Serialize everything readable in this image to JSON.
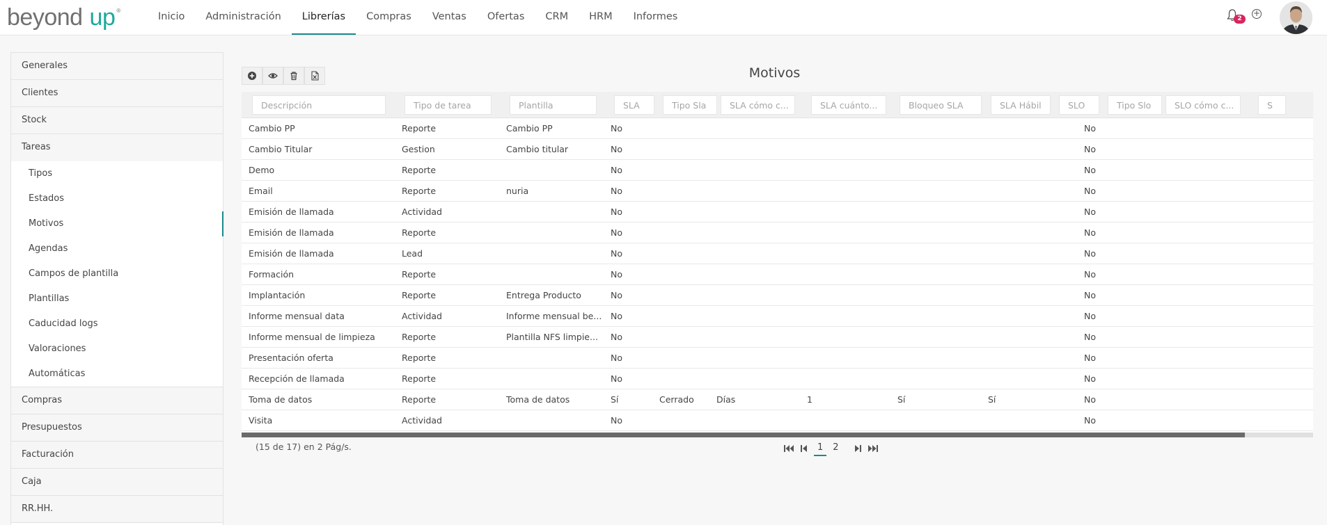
{
  "logo": {
    "word1": "beyond",
    "word2": "up",
    "reg": "®"
  },
  "nav": [
    "Inicio",
    "Administración",
    "Librerías",
    "Compras",
    "Ventas",
    "Ofertas",
    "CRM",
    "HRM",
    "Informes"
  ],
  "nav_active": "Librerías",
  "notifications": {
    "count": "2"
  },
  "sidebar": {
    "groups_top": [
      "Generales",
      "Clientes",
      "Stock",
      "Tareas"
    ],
    "tareas_subitems": [
      "Tipos",
      "Estados",
      "Motivos",
      "Agendas",
      "Campos de plantilla",
      "Plantillas",
      "Caducidad logs",
      "Valoraciones",
      "Automáticas"
    ],
    "active_subitem": "Motivos",
    "groups_bottom": [
      "Compras",
      "Presupuestos",
      "Facturación",
      "Caja",
      "RR.HH."
    ]
  },
  "page": {
    "title": "Motivos"
  },
  "toolbar": {
    "add": "add-icon",
    "view": "eye-icon",
    "delete": "trash-icon",
    "excel": "excel-icon"
  },
  "table": {
    "filters": [
      "Descripción",
      "Tipo de tarea",
      "Plantilla",
      "SLA",
      "Tipo Sla",
      "SLA cómo c...",
      "SLA cuánto...",
      "Bloqueo SLA",
      "SLA Hábil",
      "SLO",
      "Tipo Slo",
      "SLO cómo c...",
      "S"
    ],
    "rows": [
      [
        "Cambio PP",
        "Reporte",
        "Cambio PP",
        "No",
        "",
        "",
        "",
        "",
        "",
        "No"
      ],
      [
        "Cambio Titular",
        "Gestion",
        "Cambio titular",
        "No",
        "",
        "",
        "",
        "",
        "",
        "No"
      ],
      [
        "Demo",
        "Reporte",
        "",
        "No",
        "",
        "",
        "",
        "",
        "",
        "No"
      ],
      [
        "Email",
        "Reporte",
        "nuria",
        "No",
        "",
        "",
        "",
        "",
        "",
        "No"
      ],
      [
        "Emisión de llamada",
        "Actividad",
        "",
        "No",
        "",
        "",
        "",
        "",
        "",
        "No"
      ],
      [
        "Emisión de llamada",
        "Reporte",
        "",
        "No",
        "",
        "",
        "",
        "",
        "",
        "No"
      ],
      [
        "Emisión de llamada",
        "Lead",
        "",
        "No",
        "",
        "",
        "",
        "",
        "",
        "No"
      ],
      [
        "Formación",
        "Reporte",
        "",
        "No",
        "",
        "",
        "",
        "",
        "",
        "No"
      ],
      [
        "Implantación",
        "Reporte",
        "Entrega Producto",
        "No",
        "",
        "",
        "",
        "",
        "",
        "No"
      ],
      [
        "Informe mensual data",
        "Actividad",
        "Informe mensual be...",
        "No",
        "",
        "",
        "",
        "",
        "",
        "No"
      ],
      [
        "Informe mensual de limpieza",
        "Reporte",
        "Plantilla NFS limpie...",
        "No",
        "",
        "",
        "",
        "",
        "",
        "No"
      ],
      [
        "Presentación oferta",
        "Reporte",
        "",
        "No",
        "",
        "",
        "",
        "",
        "",
        "No"
      ],
      [
        "Recepción de llamada",
        "Reporte",
        "",
        "No",
        "",
        "",
        "",
        "",
        "",
        "No"
      ],
      [
        "Toma de datos",
        "Reporte",
        "Toma de datos",
        "Sí",
        "Cerrado",
        "Días",
        "1",
        "Sí",
        "Sí",
        "No"
      ],
      [
        "Visita",
        "Actividad",
        "",
        "No",
        "",
        "",
        "",
        "",
        "",
        "No"
      ]
    ]
  },
  "pager": {
    "info": "(15 de 17) en 2 Pág/s.",
    "pages": [
      "1",
      "2"
    ],
    "current": "1"
  },
  "colors": {
    "accent": "#1a8a8a",
    "brand": "#1ea99b",
    "badge": "#d7265e"
  }
}
